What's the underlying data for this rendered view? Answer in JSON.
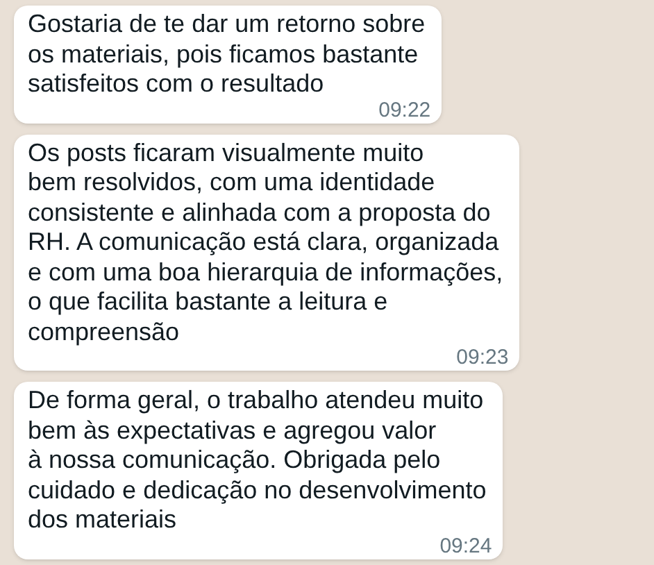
{
  "messages": [
    {
      "text": "Gostaria de te dar um retorno sobre\nos materiais, pois ficamos bastante\nsatisfeitos com o resultado",
      "time": "09:22"
    },
    {
      "text": "Os posts ficaram visualmente muito\nbem resolvidos, com uma identidade\nconsistente e alinhada com a proposta do\nRH. A comunicação está clara, organizada\ne com uma boa hierarquia de informações,\no que facilita bastante a leitura e\ncompreensão",
      "time": "09:23"
    },
    {
      "text": "De forma geral, o trabalho atendeu muito\nbem às expectativas e agregou valor\nà nossa comunicação. Obrigada pelo\ncuidado e dedicação no desenvolvimento\ndos materiais",
      "time": "09:24"
    }
  ]
}
